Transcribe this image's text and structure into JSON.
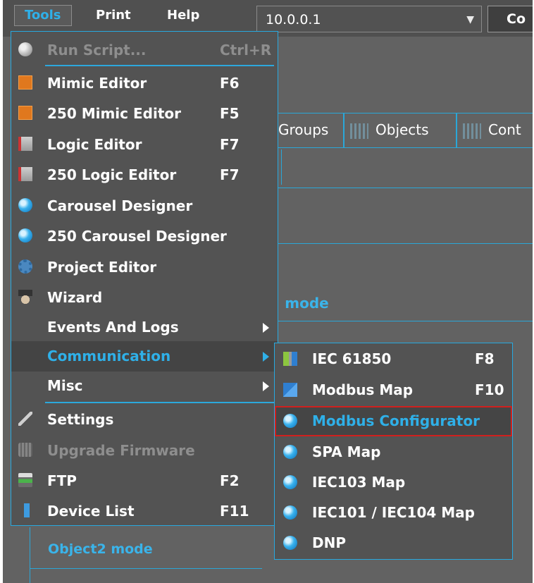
{
  "menubar": {
    "items": [
      {
        "label": "Tools",
        "active": true
      },
      {
        "label": "Print",
        "active": false
      },
      {
        "label": "Help",
        "active": false
      }
    ],
    "ip_value": "10.0.0.1",
    "connect_label": "Co"
  },
  "background": {
    "tabs": [
      {
        "label": "Groups"
      },
      {
        "label": "Objects"
      },
      {
        "label": "Cont"
      }
    ],
    "mode_label_1": "| mode",
    "mode_label_2": "Object2 mode"
  },
  "tools_menu": {
    "items": [
      {
        "label": "Run Script...",
        "shortcut": "Ctrl+R",
        "icon": "script-icon",
        "disabled": true
      },
      {
        "label": "Mimic Editor",
        "shortcut": "F6",
        "icon": "mimic-editor-icon"
      },
      {
        "label": "250 Mimic Editor",
        "shortcut": "F5",
        "icon": "mimic-editor-icon"
      },
      {
        "label": "Logic Editor",
        "shortcut": "F7",
        "icon": "logic-editor-icon"
      },
      {
        "label": "250 Logic Editor",
        "shortcut": "F7",
        "icon": "logic-editor-icon"
      },
      {
        "label": "Carousel Designer",
        "shortcut": "",
        "icon": "blue-ball-icon"
      },
      {
        "label": "250 Carousel Designer",
        "shortcut": "",
        "icon": "blue-ball-icon"
      },
      {
        "label": "Project Editor",
        "shortcut": "",
        "icon": "gear-icon"
      },
      {
        "label": "Wizard",
        "shortcut": "",
        "icon": "wizard-icon"
      },
      {
        "label": "Events And Logs",
        "shortcut": "",
        "submenu": true
      },
      {
        "label": "Communication",
        "shortcut": "",
        "submenu": true,
        "highlighted": true
      },
      {
        "label": "Misc",
        "shortcut": "",
        "submenu": true
      },
      {
        "label": "Settings",
        "shortcut": "",
        "icon": "wrench-icon"
      },
      {
        "label": "Upgrade Firmware",
        "shortcut": "",
        "icon": "chip-icon",
        "disabled": true
      },
      {
        "label": "FTP",
        "shortcut": "F2",
        "icon": "ftp-icon"
      },
      {
        "label": "Device List",
        "shortcut": "F11",
        "icon": "device-list-icon"
      }
    ]
  },
  "communication_submenu": {
    "items": [
      {
        "label": "IEC 61850",
        "shortcut": "F8",
        "icon": "iec61850-icon"
      },
      {
        "label": "Modbus Map",
        "shortcut": "F10",
        "icon": "modbus-map-icon"
      },
      {
        "label": "Modbus Configurator",
        "shortcut": "",
        "icon": "blue-ball-icon",
        "highlighted": true
      },
      {
        "label": "SPA Map",
        "shortcut": "",
        "icon": "blue-ball-icon"
      },
      {
        "label": "IEC103 Map",
        "shortcut": "",
        "icon": "blue-ball-icon"
      },
      {
        "label": "IEC101 / IEC104 Map",
        "shortcut": "",
        "icon": "blue-ball-icon"
      },
      {
        "label": "DNP",
        "shortcut": "",
        "icon": "blue-ball-icon"
      }
    ]
  },
  "colors": {
    "accent": "#2fb0e8",
    "menu_bg": "#535353",
    "app_bg": "#626262",
    "highlight_border": "#d0201e"
  }
}
